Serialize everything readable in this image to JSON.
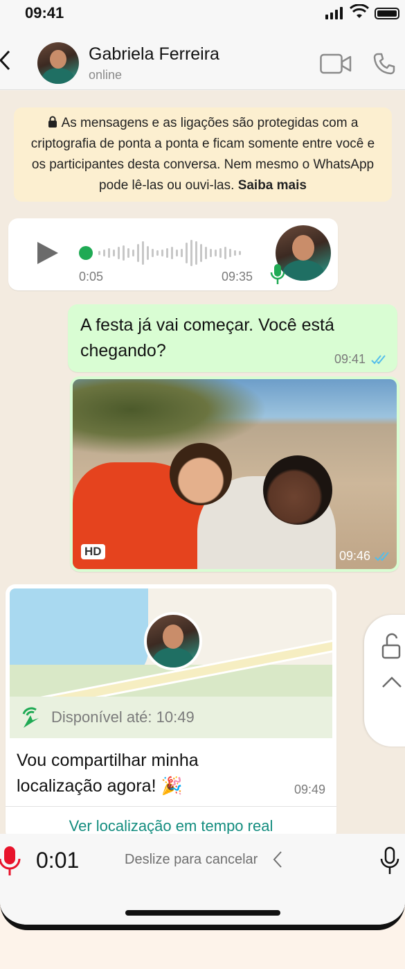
{
  "status_bar": {
    "time": "09:41"
  },
  "header": {
    "contact_name": "Gabriela Ferreira",
    "contact_status": "online"
  },
  "encryption_notice": {
    "text": "As mensagens e as ligações são protegidas com a criptografia de ponta a ponta e ficam somente entre você e os participantes desta conversa. Nem mesmo o WhatsApp pode lê-las ou ouvi-las.",
    "link": "Saiba mais"
  },
  "messages": {
    "voice": {
      "duration": "0:05",
      "time": "09:35"
    },
    "text_out": {
      "text": "A festa já vai começar. Você está chegando?",
      "time": "09:41"
    },
    "photo_out": {
      "badge": "HD",
      "time": "09:46"
    },
    "location": {
      "live_label": "Disponível até: 10:49",
      "text": "Vou compartilhar minha localização agora! 🎉",
      "time": "09:49",
      "action": "Ver localização em tempo real"
    }
  },
  "recording": {
    "elapsed": "0:01",
    "slide_hint": "Deslize para cancelar"
  },
  "colors": {
    "accent_green": "#1faa54",
    "outgoing_bubble": "#d9fdd3",
    "link_teal": "#128c7e",
    "record_red": "#e8132b",
    "read_ticks": "#53bdeb"
  }
}
